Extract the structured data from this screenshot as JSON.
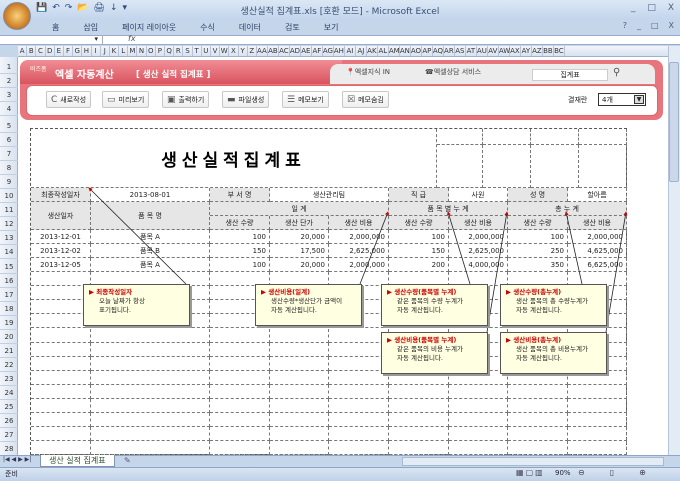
{
  "window": {
    "title": "생산실적 집계표.xls [호환 모드] - Microsoft Excel",
    "controls": [
      "_",
      "□",
      "X"
    ]
  },
  "qat": [
    "💾",
    "↶",
    "↷",
    "📂",
    "🖨",
    "↓",
    "▾"
  ],
  "ribbon": {
    "tabs": [
      "홈",
      "삽입",
      "페이지 레이아웃",
      "수식",
      "데이터",
      "검토",
      "보기"
    ],
    "controls": [
      "?",
      "_",
      "□",
      "X"
    ]
  },
  "formula": {
    "fx": "fx",
    "name": ""
  },
  "columns": [
    "A",
    "B",
    "C",
    "D",
    "E",
    "F",
    "G",
    "H",
    "I",
    "J",
    "K",
    "L",
    "M",
    "N",
    "O",
    "P",
    "Q",
    "R",
    "S",
    "T",
    "U",
    "V",
    "W",
    "X",
    "Y",
    "Z",
    "AA",
    "AB",
    "AC",
    "AD",
    "AE",
    "AF",
    "AG",
    "AH",
    "AI",
    "AJ",
    "AK",
    "AL",
    "AM",
    "AN",
    "AO",
    "AP",
    "AQ",
    "AR",
    "AS",
    "AT",
    "AU",
    "AV",
    "AW",
    "AX",
    "AY",
    "AZ",
    "BB",
    "BC"
  ],
  "rows": [
    "1",
    "2",
    "3",
    "4",
    "5",
    "6",
    "7",
    "8",
    "9",
    "10",
    "11",
    "12",
    "13",
    "14",
    "15",
    "16",
    "17",
    "18",
    "19",
    "20",
    "21",
    "22",
    "23",
    "24",
    "25",
    "26",
    "27",
    "28"
  ],
  "banner": {
    "brand_small": "비즈폼",
    "brand": "엑셀 자동계산",
    "subtitle": "[ 생산 실적 집계표 ]",
    "tab1": "엑셀지식 IN",
    "tab2": "엑셀상담 서비스",
    "search_value": "집계표",
    "buttons": [
      {
        "icon": "C",
        "label": "새로작성"
      },
      {
        "icon": "▭",
        "label": "미리보기"
      },
      {
        "icon": "▣",
        "label": "출력하기"
      },
      {
        "icon": "▬",
        "label": "파일생성"
      },
      {
        "icon": "☰",
        "label": "메모보기"
      },
      {
        "icon": "☒",
        "label": "메모숨김"
      }
    ],
    "approval_label": "결재란",
    "approval_value": "4개"
  },
  "report": {
    "title": "생산실적집계표",
    "info": {
      "date_label": "최종작성일자",
      "date": "2013-08-01",
      "dept_label": "부 서 명",
      "dept": "생산관리팀",
      "rank_label": "직    급",
      "rank": "사원",
      "name_label": "성    명",
      "name": "할아름"
    },
    "headers": {
      "prod_date": "생산일자",
      "item": "품    목    명",
      "daily": "일        계",
      "item_cum": "품 목 별 누 계",
      "total_cum": "총    누    계",
      "qty": "생산 수량",
      "unit": "생산 단가",
      "cost": "생산 비용"
    },
    "data": [
      {
        "date": "2013-12-01",
        "item": "품목 A",
        "qty": "100",
        "unit": "20,000",
        "cost": "2,000,000",
        "iqty": "100",
        "icost": "2,000,000",
        "tqty": "100",
        "tcost": "2,000,000"
      },
      {
        "date": "2013-12-02",
        "item": "품목 B",
        "qty": "150",
        "unit": "17,500",
        "cost": "2,625,000",
        "iqty": "150",
        "icost": "2,625,000",
        "tqty": "250",
        "tcost": "4,625,000"
      },
      {
        "date": "2013-12-05",
        "item": "품목 A",
        "qty": "100",
        "unit": "20,000",
        "cost": "2,000,000",
        "iqty": "200",
        "icost": "4,000,000",
        "tqty": "350",
        "tcost": "6,625,000"
      }
    ]
  },
  "notes": [
    {
      "title": "▶ 최종작성일자",
      "l1": "오늘 날짜가 항상",
      "l2": "표기됩니다."
    },
    {
      "title": "▶ 생산비용(일계)",
      "l1": "생산수량*생산단가 금액이",
      "l2": "자동 계산됩니다."
    },
    {
      "title": "▶ 생산수량(품목별 누계)",
      "l1": "같은 품목의 수량 누계가",
      "l2": "자동 계산됩니다."
    },
    {
      "title": "▶ 생산수량(총누계)",
      "l1": "생산 품목의 총 수량누계가",
      "l2": "자동 계산됩니다."
    },
    {
      "title": "▶ 생산비용(품목별 누계)",
      "l1": "같은 품목의 비용 누계가",
      "l2": "자동 계산됩니다."
    },
    {
      "title": "▶ 생산비용(총누계)",
      "l1": "생산 품목의 총 비용누계가",
      "l2": "자동 계산됩니다."
    }
  ],
  "sheet_tab": "생산 실적 집계표",
  "status": {
    "ready": "준비",
    "zoom": "90%"
  }
}
